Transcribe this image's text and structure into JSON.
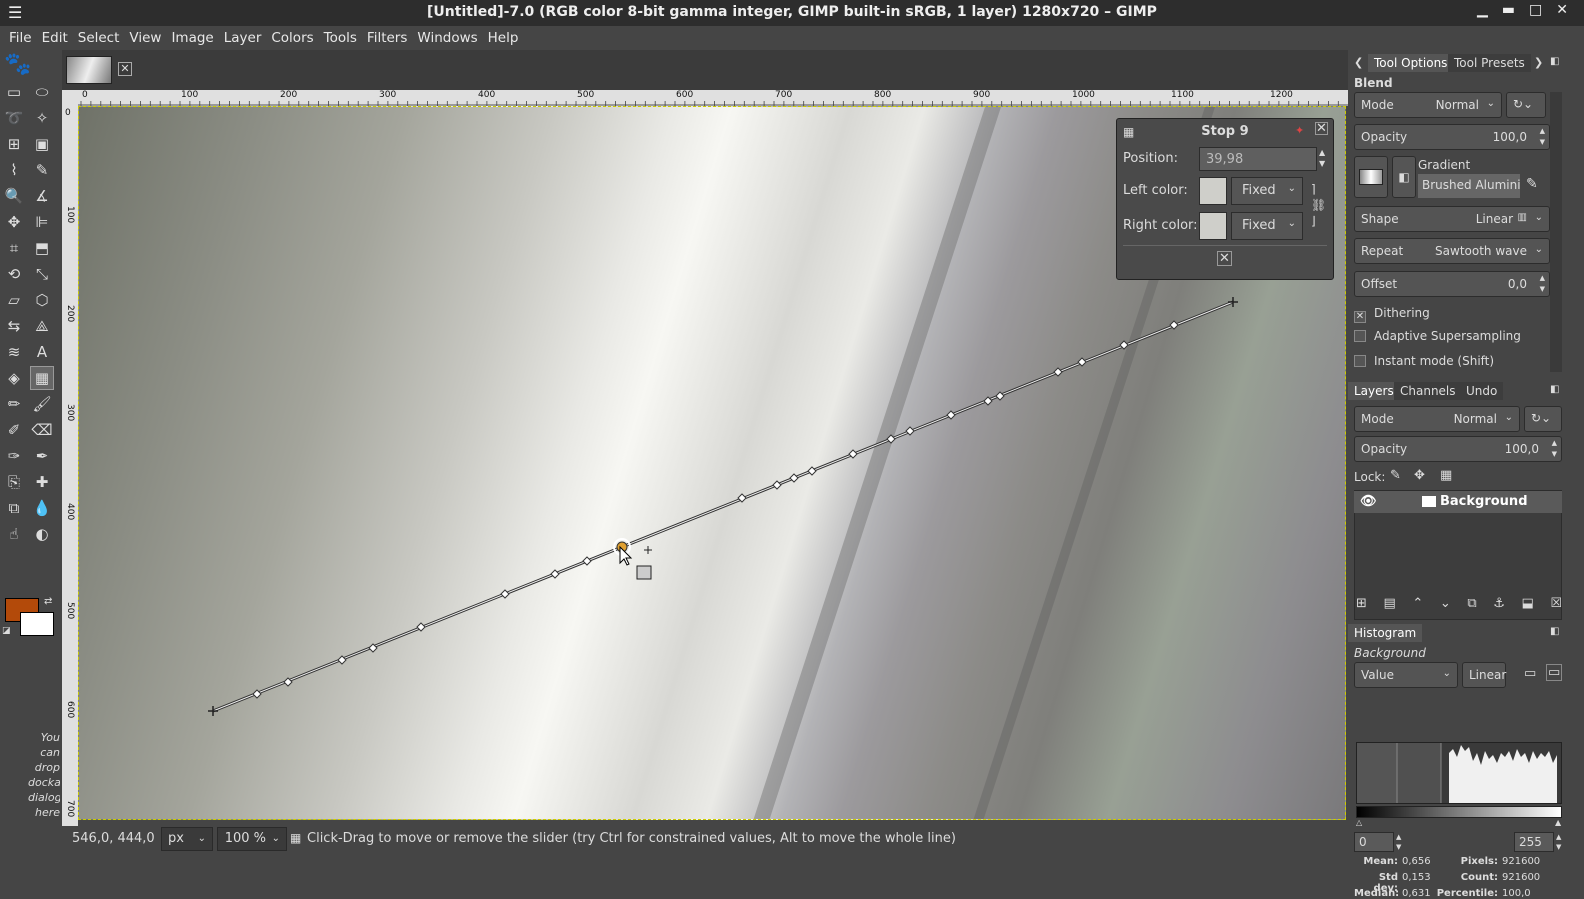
{
  "window": {
    "title": "[Untitled]-7.0 (RGB color 8-bit gamma integer, GIMP built-in sRGB, 1 layer) 1280x720 – GIMP",
    "menu_icon": "hamburger-icon",
    "controls": [
      "minimize-icon",
      "maximize-icon",
      "restore-icon",
      "close-icon"
    ]
  },
  "menubar": {
    "items": [
      "File",
      "Edit",
      "Select",
      "View",
      "Image",
      "Layer",
      "Colors",
      "Tools",
      "Filters",
      "Windows",
      "Help"
    ]
  },
  "toolbox": {
    "hint_text": "You can drop dockable dialogs here",
    "foreground_color": "#b34a0a",
    "background_color": "#ffffff"
  },
  "rulers": {
    "h_ticks": [
      "0",
      "100",
      "200",
      "300",
      "400",
      "500",
      "600",
      "700",
      "800",
      "900",
      "1000",
      "1100",
      "1200"
    ],
    "v_ticks": [
      "0",
      "100",
      "200",
      "300",
      "400",
      "500",
      "600",
      "700"
    ]
  },
  "stop_dialog": {
    "title": "Stop 9",
    "position_label": "Position:",
    "position_value": "39,98",
    "left_color_label": "Left color:",
    "left_color_mode": "Fixed",
    "right_color_label": "Right color:",
    "right_color_mode": "Fixed",
    "stop_color": "#cfcfca"
  },
  "statusbar": {
    "coords": "546,0, 444,0",
    "unit": "px",
    "zoom": "100 %",
    "message": "Click-Drag to move or remove the slider (try Ctrl for constrained values, Alt to move the whole line)"
  },
  "tool_options": {
    "tabs": [
      "Tool Options",
      "Tool Presets"
    ],
    "title": "Blend",
    "mode_label": "Mode",
    "mode_value": "Normal",
    "opacity_label": "Opacity",
    "opacity_value": "100,0",
    "gradient_label": "Gradient",
    "gradient_name": "Brushed Alumini",
    "shape_label": "Shape",
    "shape_value": "Linear",
    "repeat_label": "Repeat",
    "repeat_value": "Sawtooth wave",
    "offset_label": "Offset",
    "offset_value": "0,0",
    "dithering_label": "Dithering",
    "dithering_checked": true,
    "supersampling_label": "Adaptive Supersampling",
    "instant_label": "Instant mode  (Shift)"
  },
  "layers": {
    "tabs": [
      "Layers",
      "Channels",
      "Undo"
    ],
    "mode_label": "Mode",
    "mode_value": "Normal",
    "opacity_label": "Opacity",
    "opacity_value": "100,0",
    "lock_label": "Lock:",
    "layer_name": "Background"
  },
  "histogram": {
    "tab": "Histogram",
    "layer": "Background",
    "channel": "Value",
    "scale": "Linear",
    "range_min": "0",
    "range_max": "255",
    "mean_label": "Mean:",
    "mean": "0,656",
    "std_label": "Std dev:",
    "std": "0,153",
    "median_label": "Median:",
    "median": "0,631",
    "pixels_label": "Pixels:",
    "pixels": "921600",
    "count_label": "Count:",
    "count": "921600",
    "percentile_label": "Percentile:",
    "percentile": "100,0"
  }
}
